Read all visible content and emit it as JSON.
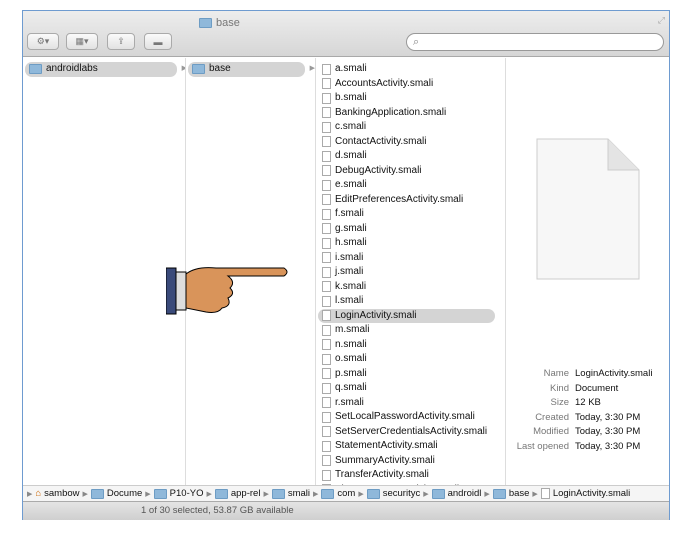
{
  "window": {
    "title": "base",
    "search_placeholder": ""
  },
  "toolbar": {
    "action": "⚙▾",
    "view": "▦▾",
    "share": "⇪",
    "toggle": "▬"
  },
  "columns": {
    "col1": "androidlabs",
    "col2": "base"
  },
  "files": [
    "a.smali",
    "AccountsActivity.smali",
    "b.smali",
    "BankingApplication.smali",
    "c.smali",
    "ContactActivity.smali",
    "d.smali",
    "DebugActivity.smali",
    "e.smali",
    "EditPreferencesActivity.smali",
    "f.smali",
    "g.smali",
    "h.smali",
    "i.smali",
    "j.smali",
    "k.smali",
    "l.smali",
    "LoginActivity.smali",
    "m.smali",
    "n.smali",
    "o.smali",
    "p.smali",
    "q.smali",
    "r.smali",
    "SetLocalPasswordActivity.smali",
    "SetServerCredentialsActivity.smali",
    "StatementActivity.smali",
    "SummaryActivity.smali",
    "TransferActivity.smali",
    "ViewStatementActivity.smali"
  ],
  "selected_file": "LoginActivity.smali",
  "info": [
    {
      "label": "Name",
      "value": "LoginActivity.smali"
    },
    {
      "label": "Kind",
      "value": "Document"
    },
    {
      "label": "Size",
      "value": "12 KB"
    },
    {
      "label": "Created",
      "value": "Today, 3:30 PM"
    },
    {
      "label": "Modified",
      "value": "Today, 3:30 PM"
    },
    {
      "label": "Last opened",
      "value": "Today, 3:30 PM"
    }
  ],
  "path": [
    "sambow",
    "Docume",
    "P10-YO",
    "app-rel",
    "smali",
    "com",
    "securityc",
    "androidl",
    "base",
    "LoginActivity.smali"
  ],
  "status": "1 of 30 selected, 53.87 GB available"
}
